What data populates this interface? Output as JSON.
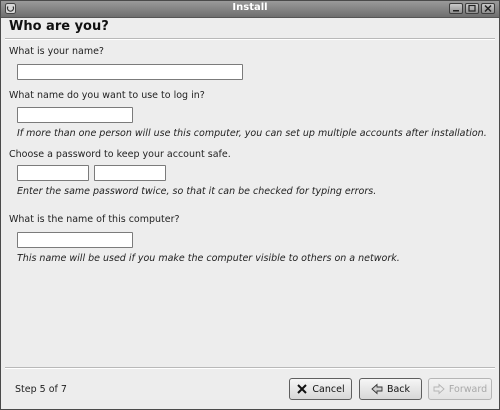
{
  "window": {
    "title": "Install",
    "controls": {
      "minimize": "minimize-icon",
      "maximize": "maximize-icon",
      "close": "close-icon"
    }
  },
  "page": {
    "title": "Who are you?"
  },
  "form": {
    "name_label": "What is your name?",
    "name_value": "",
    "login_label": "What name do you want to use to log in?",
    "login_value": "",
    "login_hint": "If more than one person will use this computer, you can set up multiple accounts after installation.",
    "password_label": "Choose a password to keep your account safe.",
    "password_value": "",
    "password_confirm_value": "",
    "password_hint": "Enter the same password twice, so that it can be checked for typing errors.",
    "computer_label": "What is the name of this computer?",
    "computer_value": "",
    "computer_hint": "This name will be used if you make the computer visible to others on a network."
  },
  "footer": {
    "step_text": "Step 5 of 7",
    "cancel_label": "Cancel",
    "back_label": "Back",
    "forward_label": "Forward",
    "forward_enabled": false
  },
  "colors": {
    "titlebar": "#7f7f7f",
    "window_bg": "#ededed",
    "disabled_text": "#a9a9a9"
  }
}
